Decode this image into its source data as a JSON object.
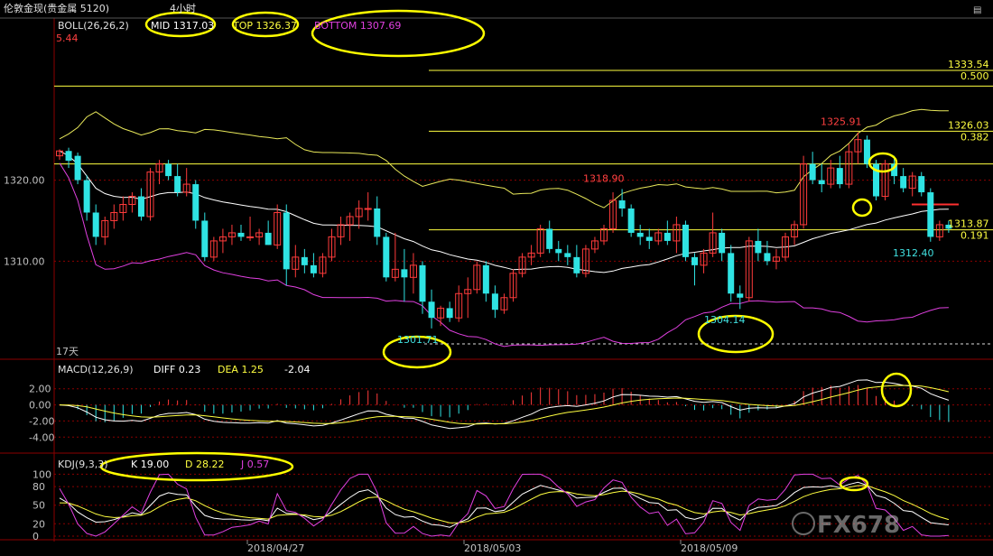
{
  "window": {
    "title": "伦敦金现(贵金属 5120)",
    "timeframe": "4小时",
    "top_left_value": "5.44"
  },
  "boll": {
    "label": "BOLL(26,26,2)",
    "mid_label": "MID 1317.03",
    "top_label": "TOP 1326.37",
    "bottom_label": "BOTTOM 1307.69"
  },
  "macd": {
    "label": "MACD(12,26,9)",
    "diff_label": "DIFF 0.23",
    "dea_label": "DEA 1.25",
    "macd_value": "-2.04"
  },
  "kdj": {
    "label": "KDJ(9,3,3)",
    "k_label": "K 19.00",
    "d_label": "D 28.22",
    "j_label": "J 0.57"
  },
  "colors": {
    "background": "#000000",
    "grid": "#8b0000",
    "up": "#ff3b3b",
    "down": "#2fe3e3",
    "boll_mid": "#ffffff",
    "boll_upper": "#e8e85a",
    "boll_lower": "#e040e0",
    "fib": "#ffff40",
    "annotation": "#ffff00",
    "text_red": "#ff4040",
    "text_cyan": "#40e0e0",
    "text_yellow": "#ffff40",
    "text_magenta": "#e040e0",
    "axis_text": "#c0c0c0"
  },
  "chart_data": {
    "type": "candlestick",
    "x_dates": [
      "2018/04/27",
      "2018/05/03",
      "2018/05/09"
    ],
    "price_ylim": [
      1297.9,
      1340.0
    ],
    "price_ticks": [
      "1320.00",
      "1310.00"
    ],
    "macd_ticks": [
      "2.00",
      "0.00",
      "-2.00",
      "-4.00"
    ],
    "kdj_ticks": [
      "100",
      "80",
      "50",
      "20",
      "0"
    ],
    "period_label": "17天",
    "fib_levels": [
      {
        "price_label": "1333.54",
        "ratio": "0.500",
        "price": 1333.54
      },
      {
        "price_label": "1326.03",
        "ratio": "0.382",
        "price": 1326.03
      },
      {
        "price_label": "1313.87",
        "ratio": "0.191",
        "price": 1313.87
      }
    ],
    "annotations": [
      {
        "text": "1325.91",
        "price": 1325.91
      },
      {
        "text": "1318.90",
        "price": 1318.9
      },
      {
        "text": "1312.40",
        "price": 1312.4
      },
      {
        "text": "1304.14",
        "price": 1304.14
      },
      {
        "text": "1301.71",
        "price": 1301.71
      }
    ],
    "candles": [
      [
        1323,
        1323.8,
        1322.5,
        1323.6
      ],
      [
        1323.6,
        1324,
        1321.5,
        1322.4
      ],
      [
        1323,
        1323.4,
        1319.5,
        1320
      ],
      [
        1320,
        1320.6,
        1315,
        1316
      ],
      [
        1316,
        1317,
        1312,
        1313
      ],
      [
        1313,
        1315.5,
        1312,
        1315
      ],
      [
        1315,
        1317,
        1314,
        1316
      ],
      [
        1316,
        1318,
        1315,
        1317
      ],
      [
        1317,
        1318.5,
        1316,
        1318
      ],
      [
        1318,
        1319,
        1315,
        1315.5
      ],
      [
        1315.5,
        1321.5,
        1315,
        1321
      ],
      [
        1321,
        1322.5,
        1319.5,
        1322
      ],
      [
        1322,
        1322.5,
        1320,
        1320.5
      ],
      [
        1320.5,
        1322,
        1318,
        1318.5
      ],
      [
        1318.5,
        1321.5,
        1318,
        1319.5
      ],
      [
        1319.5,
        1320,
        1314,
        1315
      ],
      [
        1315,
        1316,
        1310,
        1310.5
      ],
      [
        1310.5,
        1313,
        1310,
        1312.5
      ],
      [
        1312.5,
        1314,
        1311,
        1313
      ],
      [
        1313,
        1314.5,
        1312,
        1313.5
      ],
      [
        1313.5,
        1314.5,
        1312.5,
        1313
      ],
      [
        1313,
        1315.5,
        1312.5,
        1313
      ],
      [
        1313,
        1314,
        1312,
        1313.5
      ],
      [
        1313.5,
        1315,
        1312,
        1312
      ],
      [
        1312,
        1317,
        1311.5,
        1316
      ],
      [
        1316,
        1317,
        1307,
        1309
      ],
      [
        1309,
        1312,
        1308,
        1310.5
      ],
      [
        1310.5,
        1311.5,
        1308.5,
        1309.5
      ],
      [
        1309.5,
        1311,
        1308,
        1308.5
      ],
      [
        1308.5,
        1311,
        1308,
        1310.5
      ],
      [
        1310.5,
        1314,
        1310,
        1313
      ],
      [
        1313,
        1315.5,
        1312,
        1314.5
      ],
      [
        1314.5,
        1316,
        1312.5,
        1315.5
      ],
      [
        1315.5,
        1317.5,
        1314,
        1316.5
      ],
      [
        1316.5,
        1318.5,
        1315,
        1316.5
      ],
      [
        1316.5,
        1318,
        1312,
        1313
      ],
      [
        1313,
        1313.5,
        1307.5,
        1308
      ],
      [
        1308,
        1313.5,
        1307.5,
        1309
      ],
      [
        1309,
        1311.5,
        1305,
        1308
      ],
      [
        1308,
        1311,
        1306,
        1309.5
      ],
      [
        1309.5,
        1310,
        1303.5,
        1305
      ],
      [
        1305,
        1306.5,
        1301.7,
        1303
      ],
      [
        1303,
        1304.5,
        1302,
        1304.2
      ],
      [
        1304.2,
        1305,
        1302.5,
        1303
      ],
      [
        1303,
        1307,
        1302.5,
        1306
      ],
      [
        1306,
        1308,
        1303,
        1306.5
      ],
      [
        1306.5,
        1310,
        1306,
        1309.5
      ],
      [
        1309.5,
        1310,
        1305,
        1306
      ],
      [
        1306,
        1307,
        1303,
        1304
      ],
      [
        1304,
        1306,
        1303.5,
        1305.5
      ],
      [
        1305.5,
        1309,
        1305,
        1308.5
      ],
      [
        1308.5,
        1311,
        1308,
        1310.5
      ],
      [
        1310.5,
        1312,
        1309.5,
        1311
      ],
      [
        1311,
        1314.5,
        1310.5,
        1314
      ],
      [
        1314,
        1315,
        1311,
        1311.5
      ],
      [
        1311.5,
        1312.5,
        1310,
        1311
      ],
      [
        1311,
        1312,
        1309.5,
        1310.5
      ],
      [
        1310.5,
        1312,
        1308,
        1308.5
      ],
      [
        1308.5,
        1312,
        1308,
        1311.5
      ],
      [
        1311.5,
        1313,
        1311,
        1312.5
      ],
      [
        1312.5,
        1314.5,
        1312,
        1314
      ],
      [
        1314,
        1318.5,
        1313.5,
        1317.5
      ],
      [
        1317.5,
        1318.9,
        1315.5,
        1316.5
      ],
      [
        1316.5,
        1317,
        1313,
        1313.5
      ],
      [
        1313.5,
        1314.5,
        1312,
        1313
      ],
      [
        1313,
        1314,
        1311.5,
        1312.5
      ],
      [
        1312.5,
        1314,
        1312,
        1313.5
      ],
      [
        1313.5,
        1315,
        1312,
        1312.5
      ],
      [
        1312.5,
        1315.5,
        1311,
        1314.5
      ],
      [
        1314.5,
        1315,
        1310,
        1310.5
      ],
      [
        1310.5,
        1311,
        1307,
        1309.5
      ],
      [
        1309.5,
        1311.5,
        1308.5,
        1311
      ],
      [
        1311,
        1316,
        1310.5,
        1313.5
      ],
      [
        1313.5,
        1314,
        1310,
        1311
      ],
      [
        1311,
        1312,
        1305,
        1306
      ],
      [
        1306,
        1307,
        1304.1,
        1305.5
      ],
      [
        1305.5,
        1313,
        1305,
        1312.5
      ],
      [
        1312.5,
        1314,
        1310,
        1311
      ],
      [
        1311,
        1312.5,
        1309.5,
        1310
      ],
      [
        1310,
        1311.5,
        1309,
        1310.5
      ],
      [
        1310.5,
        1313.5,
        1310,
        1313
      ],
      [
        1313,
        1315,
        1312,
        1314.5
      ],
      [
        1314.5,
        1323,
        1314,
        1322
      ],
      [
        1322,
        1323.5,
        1319.5,
        1320
      ],
      [
        1320,
        1322,
        1318.5,
        1319.5
      ],
      [
        1319.5,
        1322.5,
        1319,
        1321.5
      ],
      [
        1321.5,
        1323,
        1319,
        1319.5
      ],
      [
        1319.5,
        1324.5,
        1319,
        1323.5
      ],
      [
        1323.5,
        1325.9,
        1322,
        1325
      ],
      [
        1325,
        1325.5,
        1321.5,
        1322
      ],
      [
        1322,
        1322.5,
        1317.5,
        1318
      ],
      [
        1318,
        1322.5,
        1317.5,
        1322
      ],
      [
        1322,
        1323,
        1319.5,
        1320.5
      ],
      [
        1320.5,
        1321.5,
        1318.5,
        1319
      ],
      [
        1319,
        1321,
        1318,
        1320.5
      ],
      [
        1320.5,
        1321,
        1318,
        1318.5
      ],
      [
        1318.5,
        1319,
        1312.4,
        1313
      ],
      [
        1313,
        1315,
        1312.5,
        1314.5
      ],
      [
        1314.5,
        1315,
        1313.5,
        1314
      ]
    ]
  }
}
